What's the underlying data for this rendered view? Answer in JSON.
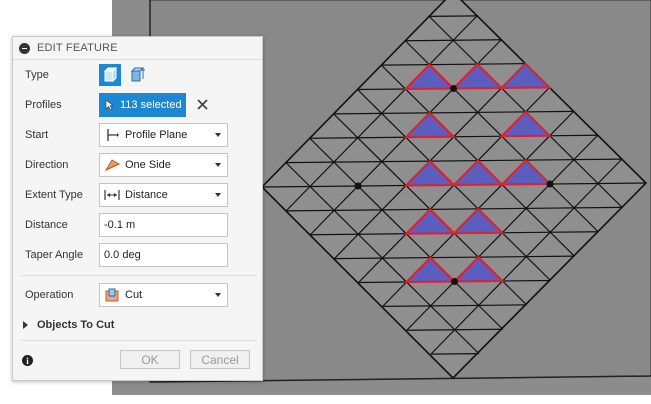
{
  "panel": {
    "title": "EDIT FEATURE",
    "type": {
      "label": "Type"
    },
    "profiles": {
      "label": "Profiles",
      "selection": "113 selected"
    },
    "start": {
      "label": "Start",
      "value": "Profile Plane"
    },
    "direction": {
      "label": "Direction",
      "value": "One Side"
    },
    "extent_type": {
      "label": "Extent Type",
      "value": "Distance"
    },
    "distance": {
      "label": "Distance",
      "value": "-0.1 m"
    },
    "taper_angle": {
      "label": "Taper Angle",
      "value": "0.0 deg"
    },
    "operation": {
      "label": "Operation",
      "value": "Cut"
    },
    "objects_to_cut": "Objects To Cut",
    "ok": "OK",
    "cancel": "Cancel"
  },
  "colors": {
    "accent": "#1e87d4",
    "canvas_gray": "#8a8a8a",
    "cut_face": "#5b5dbf",
    "cut_edge": "#e0202a"
  },
  "icons": [
    "minus-circle-icon",
    "extrude-icon",
    "thin-extrude-icon",
    "cursor-icon",
    "close-icon",
    "profile-plane-icon",
    "one-side-flag-icon",
    "distance-arrows-icon",
    "cut-icon",
    "triangle-right-icon",
    "info-icon",
    "chevron-down-icon"
  ]
}
